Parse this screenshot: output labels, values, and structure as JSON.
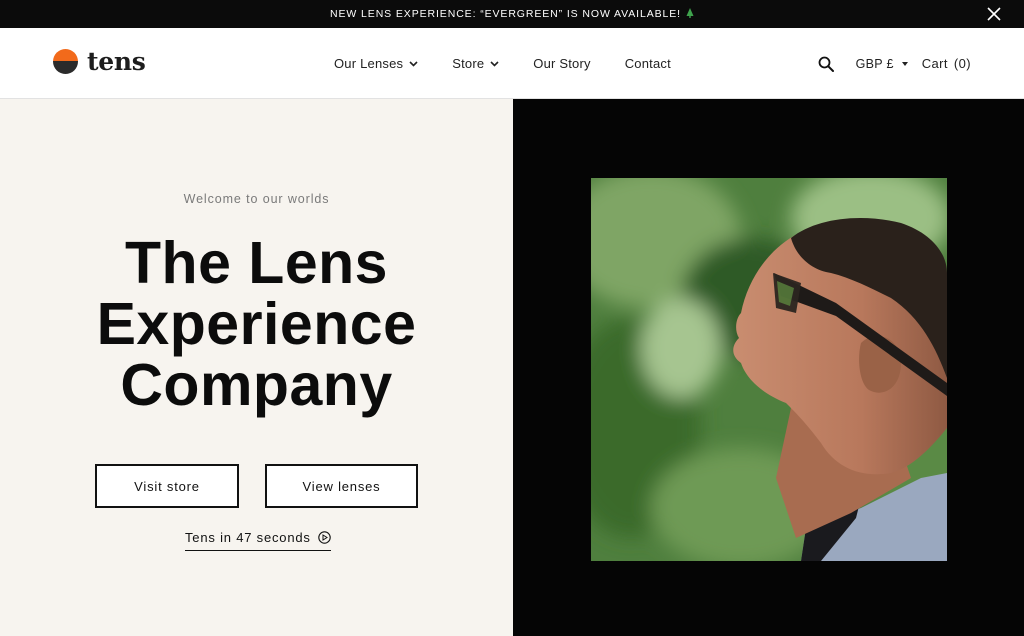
{
  "announcement": {
    "text": "NEW LENS EXPERIENCE: “EVERGREEN” IS NOW AVAILABLE!",
    "icon": "tree-icon",
    "close_icon": "close-icon"
  },
  "header": {
    "logo_text": "tens",
    "logo_colors": {
      "top": "#f26a1b",
      "bottom": "#2b2b2b"
    },
    "nav": [
      {
        "label": "Our Lenses",
        "has_dropdown": true
      },
      {
        "label": "Store",
        "has_dropdown": true
      },
      {
        "label": "Our Story",
        "has_dropdown": false
      },
      {
        "label": "Contact",
        "has_dropdown": false
      }
    ],
    "search_icon": "search-icon",
    "currency": "GBP £",
    "cart_label": "Cart",
    "cart_count": "(0)"
  },
  "hero": {
    "eyebrow": "Welcome to our worlds",
    "headline_lines": [
      "The Lens",
      "Experience",
      "Company"
    ],
    "buttons": {
      "visit_store": "Visit store",
      "view_lenses": "View lenses"
    },
    "video_link": "Tens in 47 seconds",
    "video_icon": "play-circle-icon"
  },
  "colors": {
    "announcement_bg": "#0b0b0b",
    "hero_left_bg": "#f7f4ef",
    "hero_right_bg": "#050505",
    "brand_orange": "#f26a1b"
  }
}
